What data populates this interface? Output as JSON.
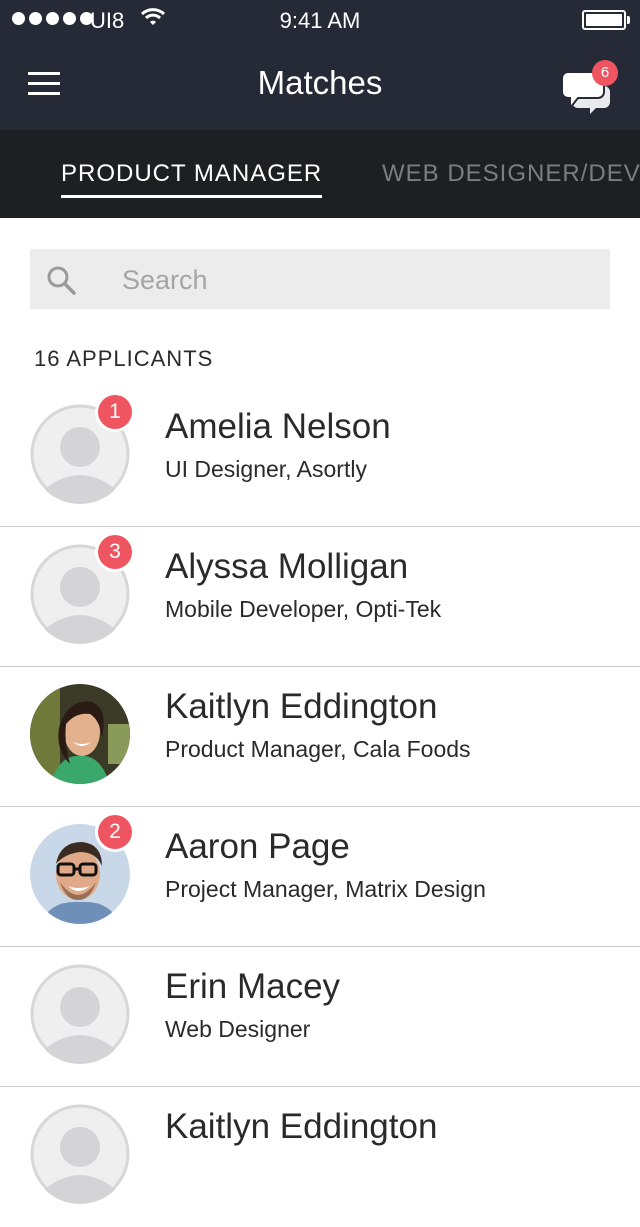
{
  "status": {
    "carrier": "UI8",
    "time": "9:41 AM"
  },
  "header": {
    "title": "Matches",
    "messages_badge": "6"
  },
  "tabs": [
    {
      "label": "PRODUCT MANAGER",
      "active": true
    },
    {
      "label": "WEB DESIGNER/DEVE",
      "active": false
    }
  ],
  "search": {
    "placeholder": "Search",
    "value": ""
  },
  "applicants": {
    "count_label": "16 APPLICANTS",
    "items": [
      {
        "name": "Amelia Nelson",
        "role": "UI Designer, Asortly",
        "badge": "1",
        "avatar": "placeholder"
      },
      {
        "name": "Alyssa Molligan",
        "role": "Mobile Developer, Opti-Tek",
        "badge": "3",
        "avatar": "placeholder"
      },
      {
        "name": "Kaitlyn Eddington",
        "role": "Product Manager, Cala Foods",
        "badge": "",
        "avatar": "photo"
      },
      {
        "name": "Aaron Page",
        "role": "Project Manager, Matrix Design",
        "badge": "2",
        "avatar": "photo"
      },
      {
        "name": "Erin Macey",
        "role": "Web Designer",
        "badge": "",
        "avatar": "placeholder"
      },
      {
        "name": "Kaitlyn Eddington",
        "role": "",
        "badge": "",
        "avatar": "placeholder"
      }
    ]
  },
  "colors": {
    "header_bg": "#262a37",
    "tabs_bg": "#1e1f22",
    "badge": "#ee5560",
    "search_bg": "#ececec"
  },
  "icons": [
    "menu-icon",
    "chat-icon",
    "search-icon",
    "wifi-icon",
    "battery-icon",
    "signal-icon"
  ]
}
